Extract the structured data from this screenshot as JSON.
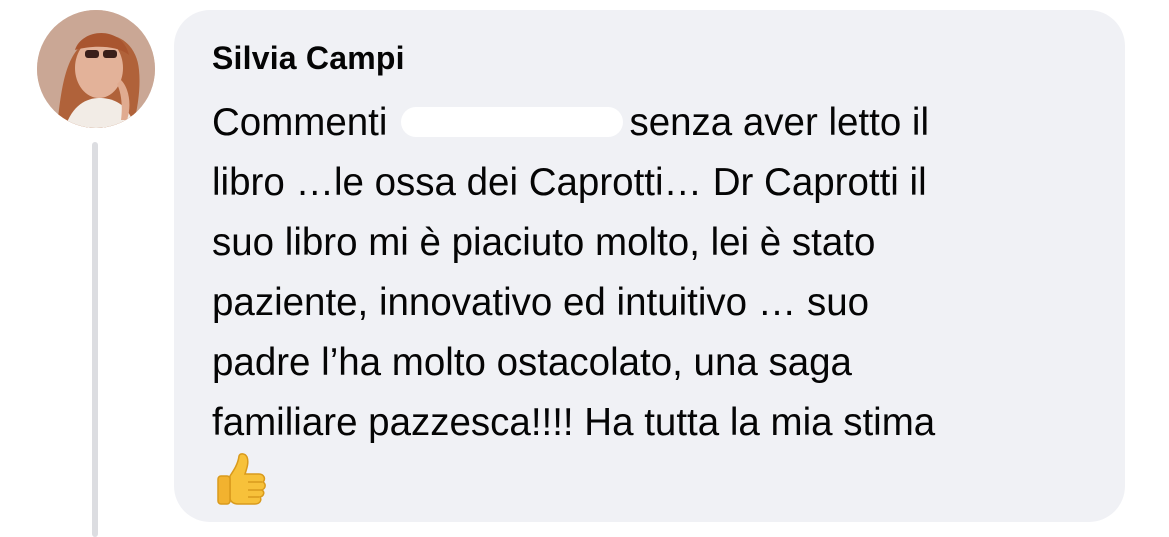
{
  "comment": {
    "author": "Silvia Campi",
    "lines": [
      {
        "before": "Commenti",
        "after": "senza aver letto il"
      },
      "libro …le ossa dei Caprotti… Dr Caprotti il",
      "suo libro mi è piaciuto molto, lei è stato",
      "paziente, innovativo ed intuitivo … suo",
      "padre l’ha molto ostacolato, una saga",
      "familiare pazzesca!!!!  Ha tutta la mia stima"
    ],
    "emoji": "thumbs-up-icon",
    "redacted_text": true
  },
  "colors": {
    "bubble_background": "#f0f1f5",
    "text": "#050505",
    "thread_line": "#dcdde1",
    "emoji_yellow": "#f7c13a"
  }
}
